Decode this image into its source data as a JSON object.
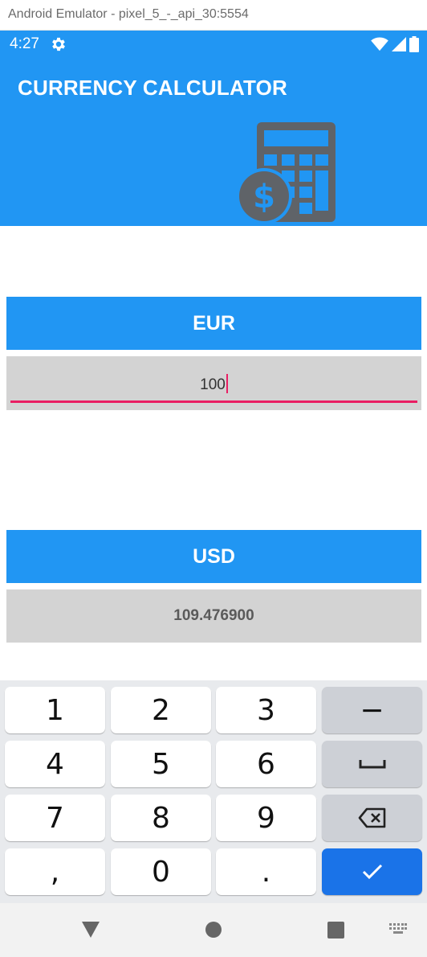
{
  "window": {
    "title": "Android Emulator - pixel_5_-_api_30:5554"
  },
  "status_bar": {
    "time": "4:27",
    "icons": [
      "gear-icon",
      "wifi-icon",
      "signal-icon",
      "battery-icon"
    ]
  },
  "app_bar": {
    "title": "CURRENCY CALCULATOR",
    "image": "calculator-dollar-icon"
  },
  "from": {
    "currency": "EUR",
    "value": "100"
  },
  "to": {
    "currency": "USD",
    "result": "109.476900"
  },
  "keyboard": {
    "rows": [
      [
        "1",
        "2",
        "3",
        "−"
      ],
      [
        "4",
        "5",
        "6",
        "space"
      ],
      [
        "7",
        "8",
        "9",
        "backspace"
      ],
      [
        ",",
        "0",
        ".",
        "done"
      ]
    ]
  },
  "nav": {
    "icons": [
      "back-icon",
      "home-icon",
      "recents-icon",
      "keyboard-switch-icon"
    ]
  },
  "colors": {
    "primary": "#2196F3",
    "accent": "#E91E63",
    "field": "#D3D3D3",
    "enter_key": "#1A73E8"
  }
}
